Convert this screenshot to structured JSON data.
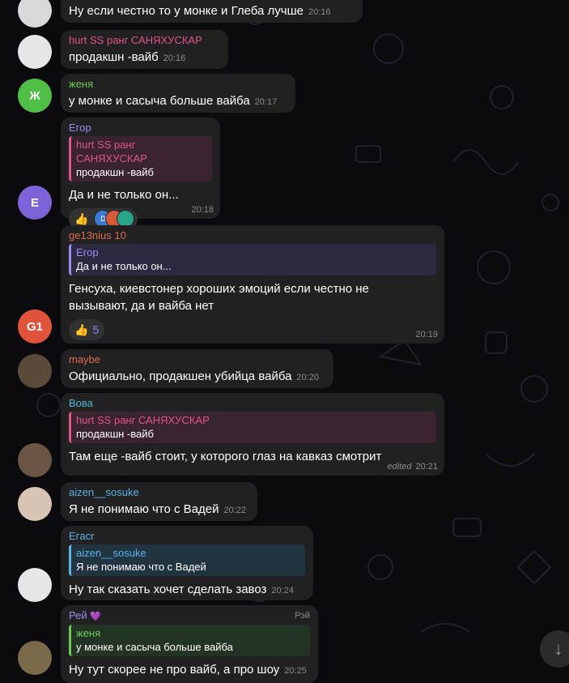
{
  "messages": [
    {
      "id": "m1",
      "sender": "",
      "text": "Ну если честно то у монке и Глеба лучше",
      "time": "20:16"
    },
    {
      "id": "m2",
      "sender": "hurt SS ранг САНЯХУСКАР",
      "text": "продакшн -вайб",
      "time": "20:16"
    },
    {
      "id": "m3",
      "sender": "женя",
      "avatar_letter": "Ж",
      "text": "у  монке и сасыча больше вайба",
      "time": "20:17"
    },
    {
      "id": "m4",
      "sender": "Егор",
      "avatar_letter": "E",
      "reply": {
        "name": "hurt SS ранг САНЯХУСКАР",
        "text": "продакшн -вайб"
      },
      "text": "Да и не только он...",
      "time": "20:18",
      "reaction_letter": "D"
    },
    {
      "id": "m5",
      "sender": "ge13nius 10",
      "avatar_letter": "G1",
      "reply": {
        "name": "Егор",
        "text": "Да и не только он..."
      },
      "text_line1": "Генсуха, киевстонер хороших эмоций если честно не",
      "text_line2": "вызывают, да и вайба нет",
      "time": "20:19",
      "reaction_count": "5"
    },
    {
      "id": "m6",
      "sender": "maybe",
      "text": "Официально, продакшен убийца вайба",
      "time": "20:20"
    },
    {
      "id": "m7",
      "sender": "Вова",
      "reply": {
        "name": "hurt SS ранг САНЯХУСКАР",
        "text": "продакшн -вайб"
      },
      "text": "Там еще -вайб стоит, у которого глаз на кавказ смотрит",
      "edited": "edited",
      "time": "20:21"
    },
    {
      "id": "m8",
      "sender": "aizen__sosuke",
      "text": "Я не понимаю что с Вадей",
      "time": "20:22"
    },
    {
      "id": "m9",
      "sender": "Eгacr",
      "reply": {
        "name": "aizen__sosuke",
        "text": "Я не понимаю что с Вадей"
      },
      "text": "Ну так сказать хочет сделать завоз",
      "time": "20:24"
    },
    {
      "id": "m10",
      "sender": "Рей",
      "tag": "Рэй",
      "reply": {
        "name": "женя",
        "text": "у монке и сасыча больше вайба"
      },
      "text": "Ну тут скорее не про вайб, а про шоу",
      "time": "20:25"
    }
  ],
  "colors": {
    "bubble": "#212121",
    "hurt": "#e0548a",
    "zhenya": "#6fc85c",
    "egor": "#9a8cf0",
    "ge13": "#e06a52",
    "maybe": "#e06a52",
    "vova": "#4fb8d8",
    "aizen": "#5bb3e6",
    "egacr": "#5bb3e6",
    "rei": "#9a8cf0"
  },
  "icons": {
    "thumbs_up": "👍",
    "scroll_down": "↓",
    "crown": "💜"
  }
}
